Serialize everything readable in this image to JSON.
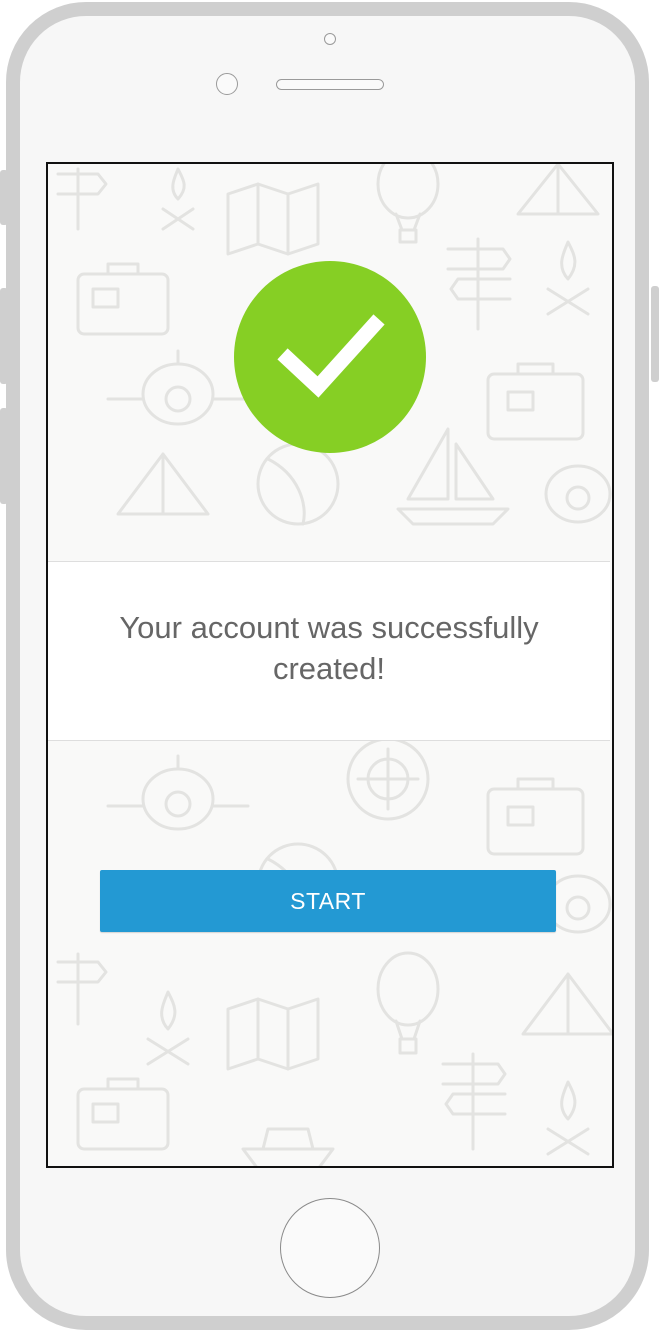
{
  "device": "smartphone",
  "colors": {
    "success_green": "#86cf24",
    "button_blue": "#2399d3",
    "message_text": "#666666",
    "screen_background": "#f9f9f8"
  },
  "success": {
    "icon": "checkmark-icon",
    "message": "Your account was successfully created!"
  },
  "actions": {
    "start_label": "START"
  }
}
